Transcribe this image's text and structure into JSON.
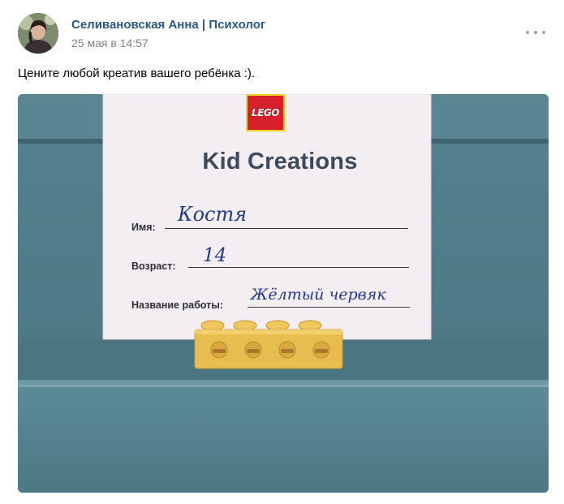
{
  "post": {
    "author": "Селивановская Анна | Психолог",
    "date": "25 мая в 14:57",
    "text": "Цените любой креатив вашего ребёнка :)."
  },
  "icons": {
    "avatar": "user-avatar-photo",
    "more": "more-dots-icon"
  },
  "photo": {
    "logo": "LEGO",
    "card_title": "Kid Creations",
    "fields": {
      "name_label": "Имя:",
      "name_value": "Костя",
      "age_label": "Возраст:",
      "age_value": "14",
      "work_label": "Название работы:",
      "work_value": "Жёлтый червяк"
    }
  },
  "colors": {
    "author_link": "#2a5885",
    "date": "#828282",
    "handwriting": "#243a8c",
    "lego_red": "#d6202b",
    "brick_yellow": "#e8bd4f"
  }
}
